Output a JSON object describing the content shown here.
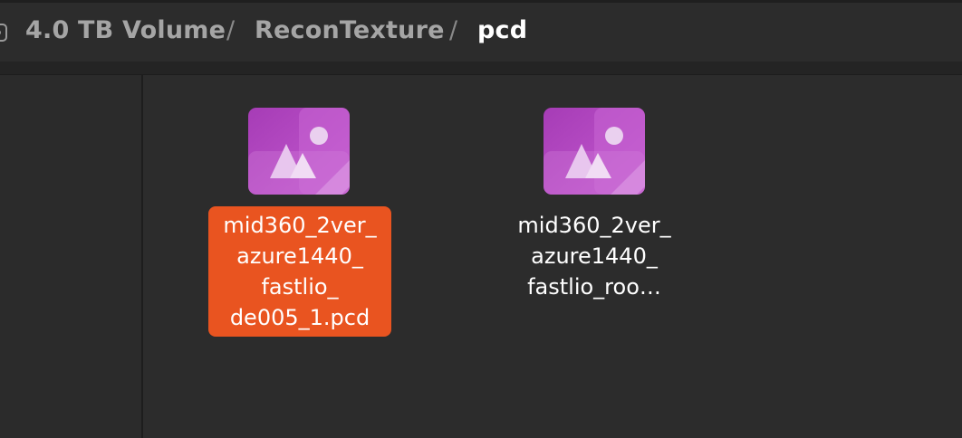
{
  "pathbar": {
    "segments": [
      {
        "label": "4.0 TB Volume"
      },
      {
        "label": "ReconTexture"
      },
      {
        "label": "pcd"
      }
    ],
    "separator": "/"
  },
  "files": [
    {
      "name": "mid360_2ver_\nazure1440_\nfastlio_\nde005_1.pcd",
      "icon": "image-file-icon",
      "selected": true
    },
    {
      "name": "mid360_2ver_\nazure1440_\nfastlio_roo…",
      "icon": "image-file-icon",
      "selected": false
    }
  ],
  "colors": {
    "selection": "#e95420",
    "icon_purple": "#a43fb8",
    "background": "#2c2c2c"
  }
}
